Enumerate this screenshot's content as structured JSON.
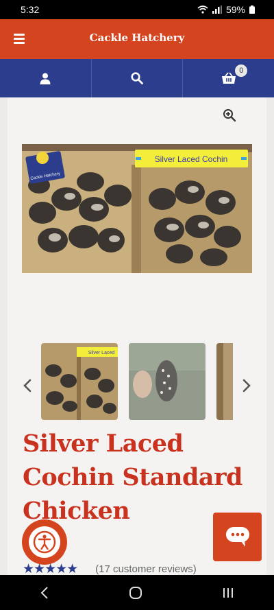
{
  "status_bar": {
    "time": "5:32",
    "battery": "59%"
  },
  "header": {
    "brand": "Cackle Hatchery",
    "menu_icon": "hamburger-menu-icon"
  },
  "nav": {
    "account_icon": "user-icon",
    "search_icon": "search-icon",
    "cart_icon": "cart-icon",
    "cart_count": "0"
  },
  "gallery": {
    "image_banner": "Silver Laced Cochin",
    "thumb_banner": "Silver Laced",
    "logo_caption": "Cackle Hatchery",
    "thumbnail_count": 3
  },
  "product": {
    "title": "Silver Laced Cochin Standard Chicken",
    "stars": "★★★★★",
    "reviews": "(17 customer reviews)"
  },
  "colors": {
    "header": "#d4451f",
    "nav": "#2b3d8c",
    "title": "#c8321f"
  }
}
